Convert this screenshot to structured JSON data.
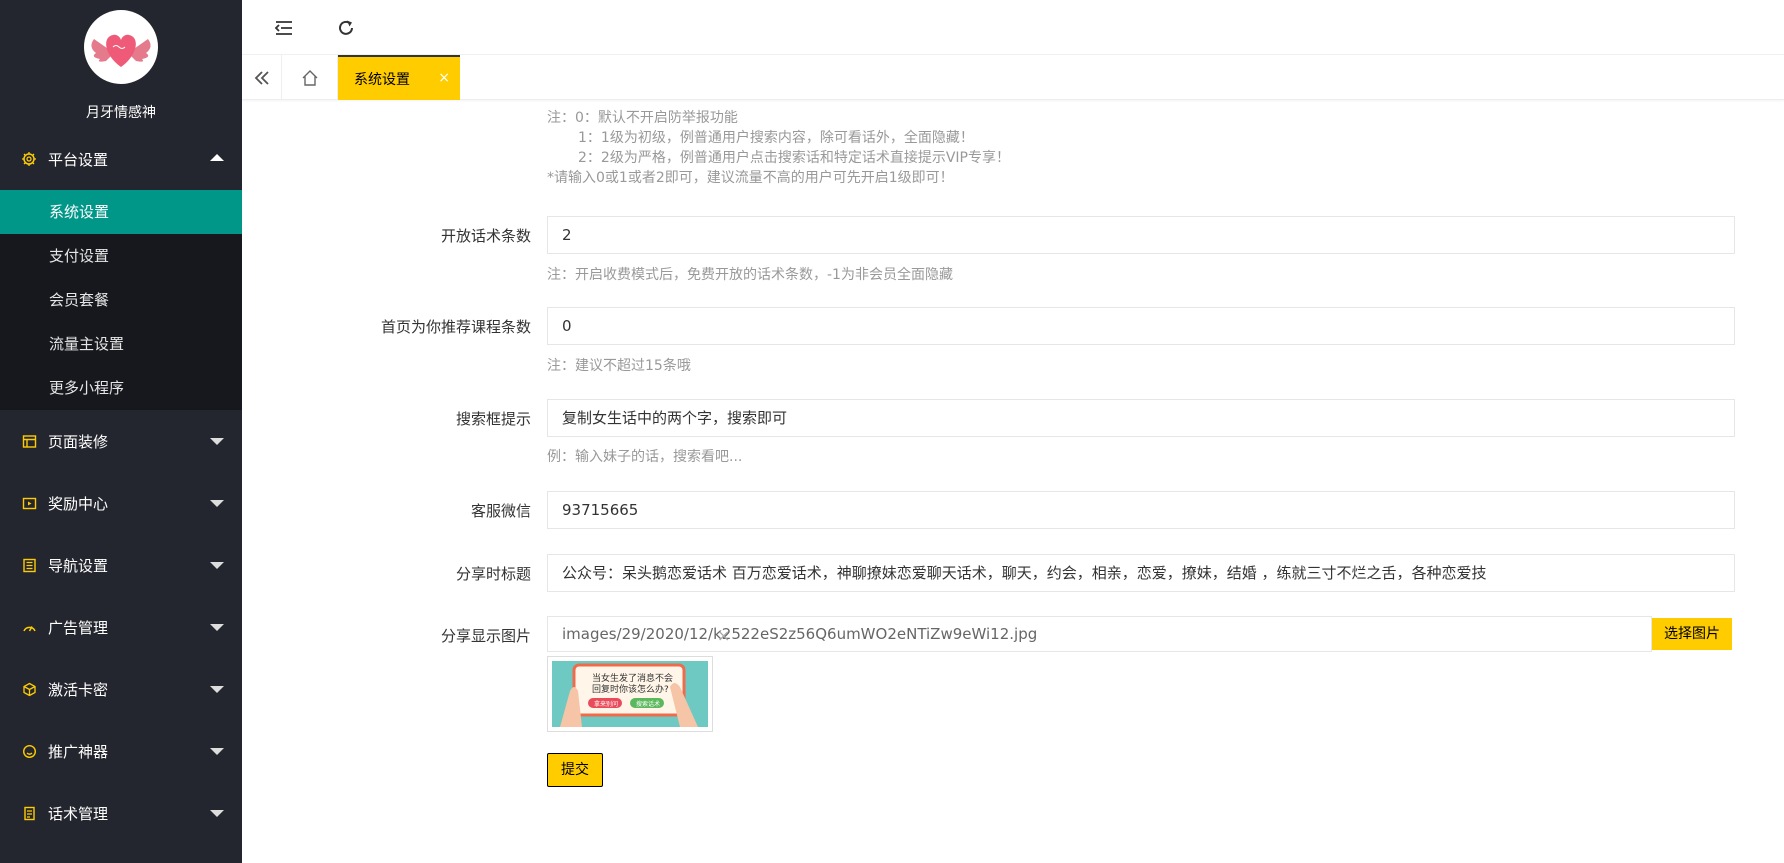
{
  "brand": {
    "name": "月牙情感神"
  },
  "sidebar": {
    "groups": [
      {
        "label": "平台设置",
        "icon": "gear-icon",
        "expanded": true
      },
      {
        "label": "页面装修",
        "icon": "layout-icon"
      },
      {
        "label": "奖励中心",
        "icon": "video-icon"
      },
      {
        "label": "导航设置",
        "icon": "nav-icon"
      },
      {
        "label": "广告管理",
        "icon": "gauge-icon"
      },
      {
        "label": "激活卡密",
        "icon": "cube-icon"
      },
      {
        "label": "推广神器",
        "icon": "smile-icon"
      },
      {
        "label": "话术管理",
        "icon": "doc-icon"
      }
    ],
    "sub_items": [
      {
        "label": "系统设置",
        "active": true
      },
      {
        "label": "支付设置"
      },
      {
        "label": "会员套餐"
      },
      {
        "label": "流量主设置"
      },
      {
        "label": "更多小程序"
      }
    ]
  },
  "topbar": {
    "icons": [
      "collapse-menu-icon",
      "refresh-icon"
    ]
  },
  "tabs": {
    "active_label": "系统设置",
    "close": "×"
  },
  "form": {
    "notes": {
      "line1": "注：0：默认不开启防举报功能",
      "line2": "1：1级为初级，例普通用户搜索内容，除可看话外，全面隐藏！",
      "line3": "2：2级为严格，例普通用户点击搜索话和特定话术直接提示VIP专享！",
      "line4": "*请输入0或1或者2即可，建议流量不高的用户可先开启1级即可！"
    },
    "open_count": {
      "label": "开放话术条数",
      "value": "2",
      "hint": "注：开启收费模式后，免费开放的话术条数，-1为非会员全面隐藏"
    },
    "recommend_count": {
      "label": "首页为你推荐课程条数",
      "value": "0",
      "hint": "注：建议不超过15条哦"
    },
    "search_hint": {
      "label": "搜索框提示",
      "value": "复制女生话中的两个字，搜索即可",
      "hint": "例：输入妹子的话，搜索看吧..."
    },
    "wechat": {
      "label": "客服微信",
      "value": "93715665"
    },
    "share_title": {
      "label": "分享时标题",
      "value": "公众号：呆头鹅恋爱话术 百万恋爱话术，神聊撩妹恋爱聊天话术，聊天，约会，相亲，恋爱，撩妹，结婚 ，练就三寸不烂之舌，各种恋爱技"
    },
    "share_image": {
      "label": "分享显示图片",
      "value": "images/29/2020/12/k2522eS2z56Q6umWO2eNTiZw9eWi12.jpg",
      "pick_label": "选择图片",
      "thumb_text1": "当女生发了消息不会",
      "thumb_text2": "回复时你该怎么办?",
      "thumb_btn1": "拿来别问",
      "thumb_btn2": "搜索话术",
      "remove": "×"
    },
    "submit_label": "提交"
  },
  "colors": {
    "accent": "#ffcc00",
    "active_menu": "#009688",
    "sidebar_bg": "#23262e"
  }
}
